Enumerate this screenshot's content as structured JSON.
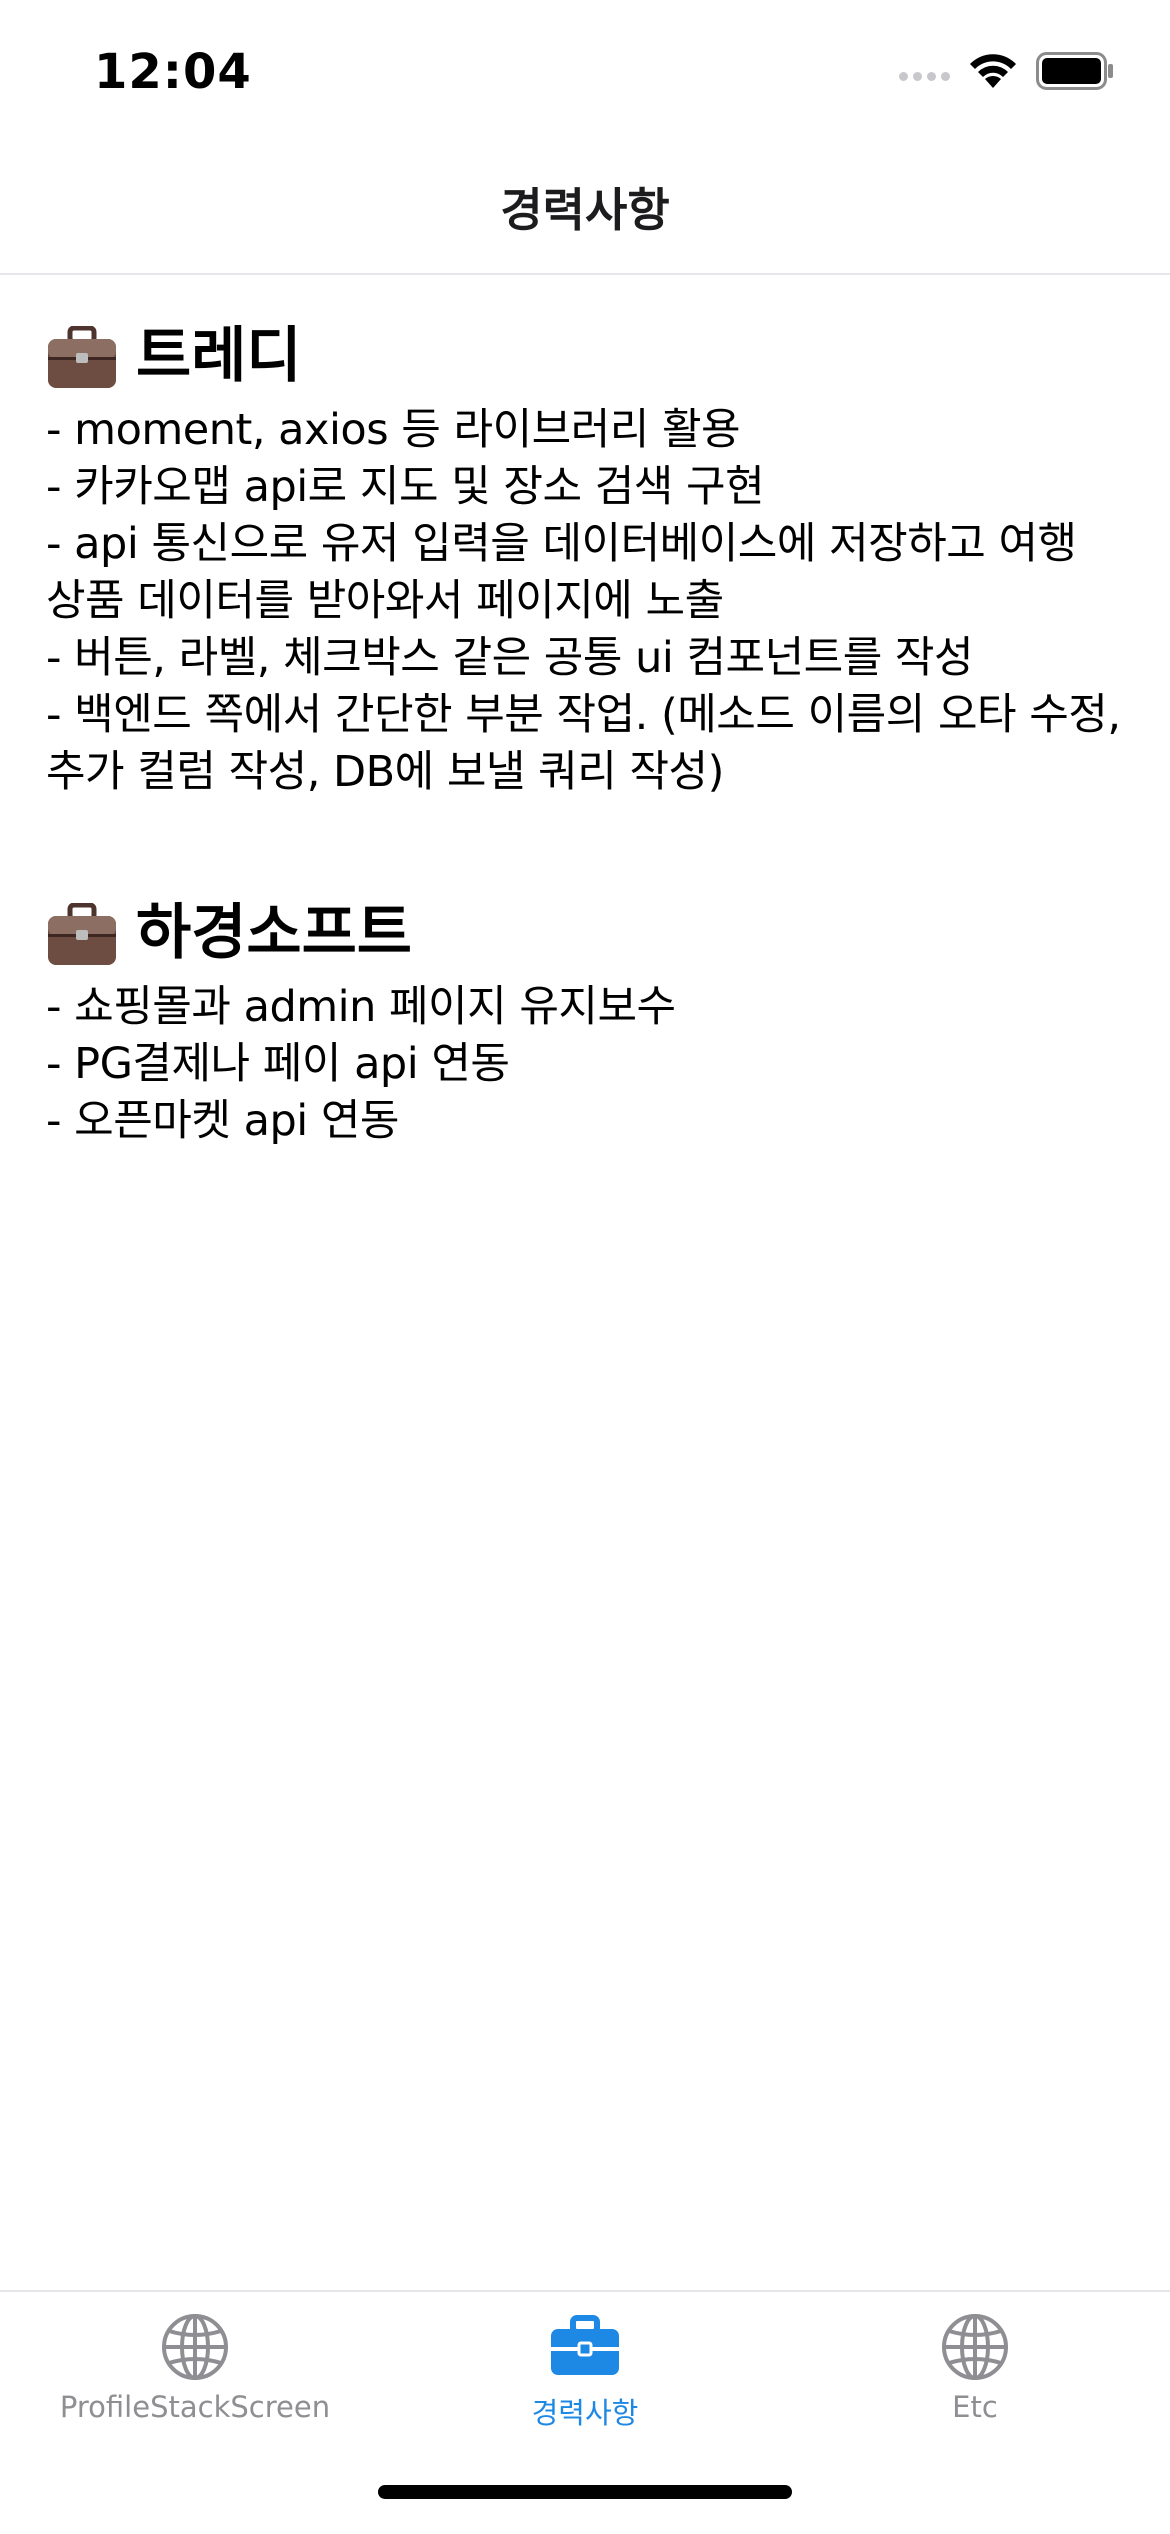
{
  "status_bar": {
    "time": "12:04"
  },
  "header": {
    "title": "경력사항"
  },
  "companies": [
    {
      "name": "트레디",
      "icon": "briefcase-icon",
      "duties": [
        "- moment, axios 등 라이브러리 활용",
        "- 카카오맵 api로 지도 및 장소 검색 구현",
        "- api 통신으로 유저 입력을 데이터베이스에 저장하고 여행 상품 데이터를 받아와서 페이지에 노출",
        "- 버튼, 라벨, 체크박스 같은 공통 ui 컴포넌트를 작성",
        "- 백엔드 쪽에서 간단한 부분 작업. (메소드 이름의 오타 수정, 추가 컬럼 작성, DB에 보낼 쿼리 작성)"
      ]
    },
    {
      "name": "하경소프트",
      "icon": "briefcase-icon",
      "duties": [
        "- 쇼핑몰과 admin 페이지 유지보수",
        "- PG결제나 페이 api 연동",
        "- 오픈마켓 api 연동"
      ]
    }
  ],
  "tabs": [
    {
      "label": "ProfileStackScreen",
      "icon": "globe-icon",
      "active": false
    },
    {
      "label": "경력사항",
      "icon": "briefcase-icon",
      "active": true
    },
    {
      "label": "Etc",
      "icon": "globe-icon",
      "active": false
    }
  ],
  "colors": {
    "accent": "#1e88e5",
    "inactive": "#8e8e93",
    "briefcase": "#6d4c41"
  }
}
